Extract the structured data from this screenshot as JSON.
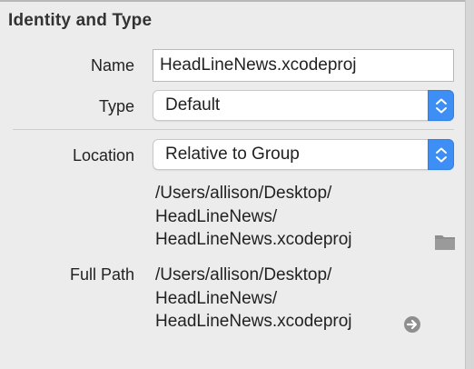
{
  "section": {
    "title": "Identity and Type"
  },
  "fields": {
    "name_label": "Name",
    "name_value": "HeadLineNews.xcodeproj",
    "type_label": "Type",
    "type_value": "Default",
    "location_label": "Location",
    "location_value": "Relative to Group",
    "location_path": {
      "line1": "/Users/allison/Desktop/",
      "line2": "HeadLineNews/",
      "line3": "HeadLineNews.xcodeproj"
    },
    "full_path_label": "Full Path",
    "full_path": {
      "line1": "/Users/allison/Desktop/",
      "line2": "HeadLineNews/",
      "line3": "HeadLineNews.xcodeproj"
    }
  },
  "icons": {
    "folder": "folder-icon",
    "reveal": "arrow-circle-right-icon",
    "stepper": "up-down-chevron-icon"
  },
  "colors": {
    "accent": "#3d8ef5",
    "panel_bg": "#ececec",
    "icon_gray": "#8e8e8e"
  }
}
